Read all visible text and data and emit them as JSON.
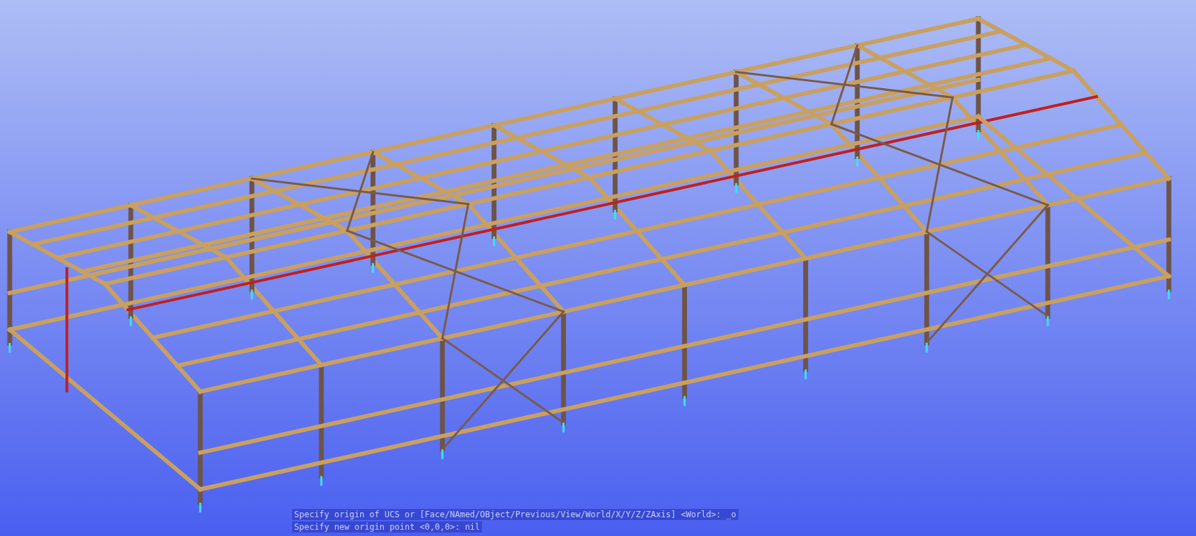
{
  "command_line": [
    "Specify origin of UCS or [Face/NAmed/OBject/Previous/View/World/X/Y/Z/ZAxis] <World>: _o",
    "Specify new origin point <0,0,0>: nil"
  ]
}
